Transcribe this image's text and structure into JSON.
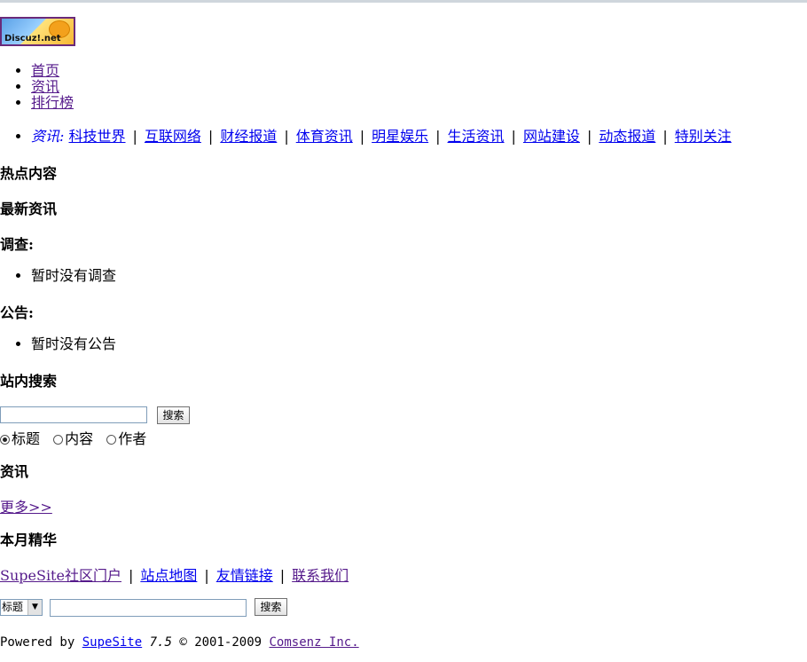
{
  "logo": {
    "text": "Discuz!.net"
  },
  "nav": [
    "首页",
    "资讯",
    "排行榜"
  ],
  "categories": {
    "label": "资讯:",
    "items": [
      "科技世界",
      "互联网络",
      "财经报道",
      "体育资讯",
      "明星娱乐",
      "生活资讯",
      "网站建设",
      "动态报道",
      "特别关注"
    ],
    "separator": "|"
  },
  "sections": {
    "hot": "热点内容",
    "latest": "最新资讯",
    "poll_title": "调查:",
    "poll_empty": "暂时没有调查",
    "announce_title": "公告:",
    "announce_empty": "暂时没有公告",
    "search_title": "站内搜索",
    "news_title": "资讯",
    "more_link": "更多>>",
    "monthly": "本月精华"
  },
  "search": {
    "button": "搜索",
    "options": [
      "标题",
      "内容",
      "作者"
    ],
    "selected": "标题"
  },
  "footer": {
    "links": [
      "SupeSite社区门户",
      "站点地图",
      "友情链接",
      "联系我们"
    ],
    "select_value": "标题",
    "search_button": "搜索",
    "powered_prefix": "Powered by",
    "product": "SupeSite",
    "version": "7.5",
    "copyright": "© 2001-2009",
    "company": "Comsenz Inc."
  }
}
